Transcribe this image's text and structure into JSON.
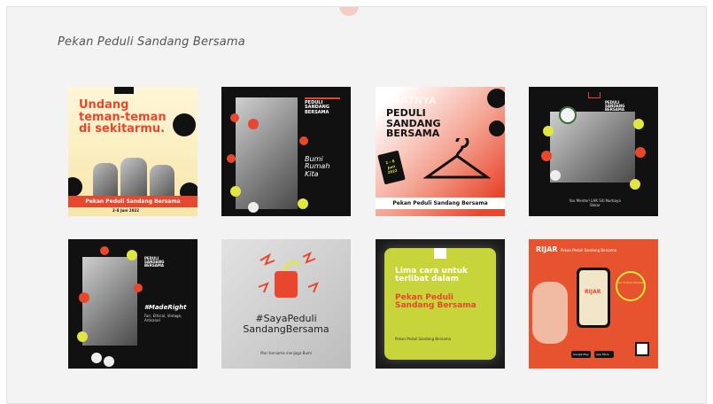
{
  "section": {
    "title": "Pekan Peduli Sandang Bersama"
  },
  "tiles": [
    {
      "headline": "Undang teman-teman di sekitarmu.",
      "band": "Pekan Peduli Sandang Bersama",
      "date": "2–8 Juni 2022"
    },
    {
      "headline": "Bumi Rumah Kita",
      "tag": "PEDULI SANDANG BERSAMA"
    },
    {
      "top": "SAATNYA",
      "headline": "PEDULI SANDANG BERSAMA",
      "tag_date": "2 – 8 Juni 2022",
      "band": "Pekan Peduli Sandang Bersama"
    },
    {
      "tag": "PEDULI SANDANG BERSAMA",
      "caption": "Ibu Menteri LHK Siti Nurbaya Bakar"
    },
    {
      "headline": "#MadeRight",
      "sub": "Fair, Ethical, Vintage, Artisanal",
      "tag": "PEDULI SANDANG BERSAMA"
    },
    {
      "headline": "#SayaPeduli SandangBersama",
      "sub": "Mari bersama menjaga Bumi"
    },
    {
      "headline": "Lima cara untuk terlibat dalam",
      "highlight": "Pekan Peduli Sandang Bersama",
      "sub": "Pekan Peduli Sandang Bersama"
    },
    {
      "brand": "RIJAR",
      "sub": "Pekan Peduli Sandang Bersama",
      "badge": "AYO TUKAR PAKAIAN",
      "store1": "Google Play",
      "store2": "App Store"
    }
  ]
}
